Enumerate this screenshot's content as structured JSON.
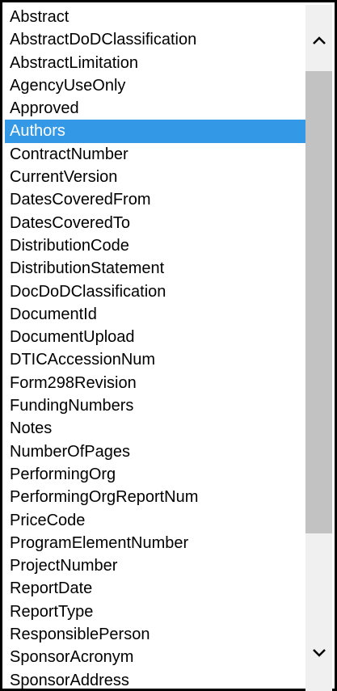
{
  "listbox": {
    "items": [
      "Abstract",
      "AbstractDoDClassification",
      "AbstractLimitation",
      "AgencyUseOnly",
      "Approved",
      "Authors",
      "ContractNumber",
      "CurrentVersion",
      "DatesCoveredFrom",
      "DatesCoveredTo",
      "DistributionCode",
      "DistributionStatement",
      "DocDoDClassification",
      "DocumentId",
      "DocumentUpload",
      "DTICAccessionNum",
      "Form298Revision",
      "FundingNumbers",
      "Notes",
      "NumberOfPages",
      "PerformingOrg",
      "PerformingOrgReportNum",
      "PriceCode",
      "ProgramElementNumber",
      "ProjectNumber",
      "ReportDate",
      "ReportType",
      "ResponsiblePerson",
      "SponsorAcronym",
      "SponsorAddress"
    ],
    "selected_item": "Authors",
    "selection_color": "#3399e6",
    "scrollbar": {
      "up_icon": "chevron-up-icon",
      "down_icon": "chevron-down-icon"
    }
  }
}
